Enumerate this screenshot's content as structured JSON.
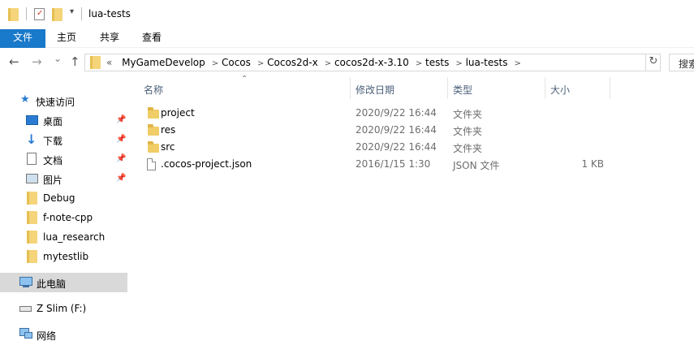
{
  "window": {
    "title": "lua-tests"
  },
  "ribbon": {
    "tabs": [
      {
        "label": "文件",
        "active": true
      },
      {
        "label": "主页"
      },
      {
        "label": "共享"
      },
      {
        "label": "查看"
      }
    ]
  },
  "navigation": {
    "back_icon": "←",
    "forward_icon": "→",
    "recent_icon": "⌄",
    "up_icon": "↑",
    "breadcrumb_prefix": "«",
    "breadcrumbs": [
      "MyGameDevelop",
      "Cocos",
      "Cocos2d-x",
      "cocos2d-x-3.10",
      "tests",
      "lua-tests"
    ],
    "refresh_icon": "↻",
    "search_placeholder": "搜索"
  },
  "sidebar": {
    "quick_access": "快速访问",
    "items": [
      {
        "label": "桌面",
        "icon": "desktop-icon",
        "pinned": true
      },
      {
        "label": "下载",
        "icon": "download-icon",
        "pinned": true
      },
      {
        "label": "文档",
        "icon": "documents-icon",
        "pinned": true
      },
      {
        "label": "图片",
        "icon": "pictures-icon",
        "pinned": true
      },
      {
        "label": "Debug",
        "icon": "folder-icon",
        "pinned": false
      },
      {
        "label": "f-note-cpp",
        "icon": "folder-icon",
        "pinned": false
      },
      {
        "label": "lua_research",
        "icon": "folder-icon",
        "pinned": false
      },
      {
        "label": "mytestlib",
        "icon": "folder-icon",
        "pinned": false
      }
    ],
    "this_pc": "此电脑",
    "drive": "Z Slim (F:)",
    "network": "网络"
  },
  "columns": {
    "name": "名称",
    "date": "修改日期",
    "type": "类型",
    "size": "大小"
  },
  "files": [
    {
      "name": "project",
      "date": "2020/9/22 16:44",
      "type": "文件夹",
      "size": "",
      "kind": "folder"
    },
    {
      "name": "res",
      "date": "2020/9/22 16:44",
      "type": "文件夹",
      "size": "",
      "kind": "folder"
    },
    {
      "name": "src",
      "date": "2020/9/22 16:44",
      "type": "文件夹",
      "size": "",
      "kind": "folder"
    },
    {
      "name": ".cocos-project.json",
      "date": "2016/1/15 1:30",
      "type": "JSON 文件",
      "size": "1 KB",
      "kind": "file"
    }
  ],
  "colors": {
    "accent": "#1979ca",
    "selected_bg": "#d9d9d9",
    "folder": "#f0cd66",
    "header_text": "#4c607a"
  }
}
